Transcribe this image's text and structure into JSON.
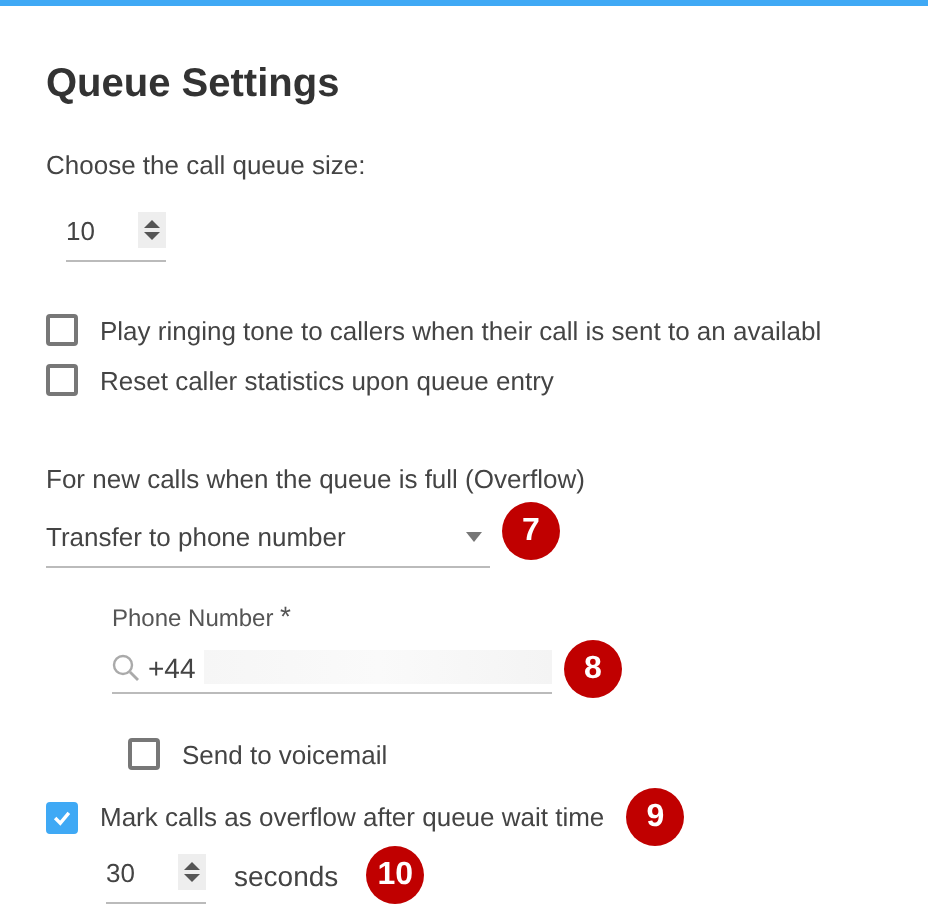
{
  "title": "Queue Settings",
  "queue_size": {
    "label": "Choose the call queue size:",
    "value": "10"
  },
  "options": [
    {
      "label": "Play ringing tone to callers when their call is sent to an availabl",
      "checked": false
    },
    {
      "label": "Reset caller statistics upon queue entry",
      "checked": false
    }
  ],
  "overflow": {
    "label": "For new calls when the queue is full (Overflow)",
    "dropdown": {
      "value": "Transfer to phone number",
      "badge": "7"
    },
    "phone": {
      "label": "Phone Number",
      "required_mark": "*",
      "value": "+44",
      "badge": "8"
    },
    "voicemail": {
      "label": "Send to voicemail",
      "checked": false
    },
    "mark_overflow": {
      "label": "Mark calls as overflow after queue wait time",
      "checked": true,
      "badge": "9"
    },
    "wait": {
      "value": "30",
      "unit": "seconds",
      "badge": "10"
    }
  }
}
